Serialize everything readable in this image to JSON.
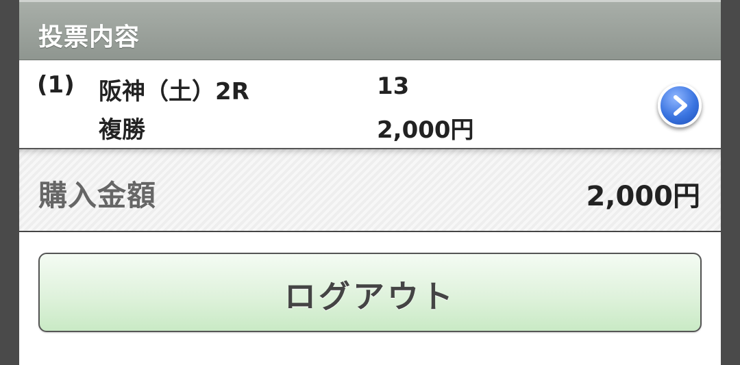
{
  "section": {
    "title": "投票内容"
  },
  "bet": {
    "number": "(1)",
    "race": "阪神（土）2R",
    "bet_type": "複勝",
    "horse": "13",
    "amount": "2,000円",
    "detail_icon": "chevron-right-icon"
  },
  "total": {
    "label": "購入金額",
    "value": "2,000円"
  },
  "logout": {
    "label": "ログアウト"
  },
  "colors": {
    "header_bg": "#969c97",
    "button_green": "#d6efd3",
    "arrow_blue": "#3a74e0"
  }
}
